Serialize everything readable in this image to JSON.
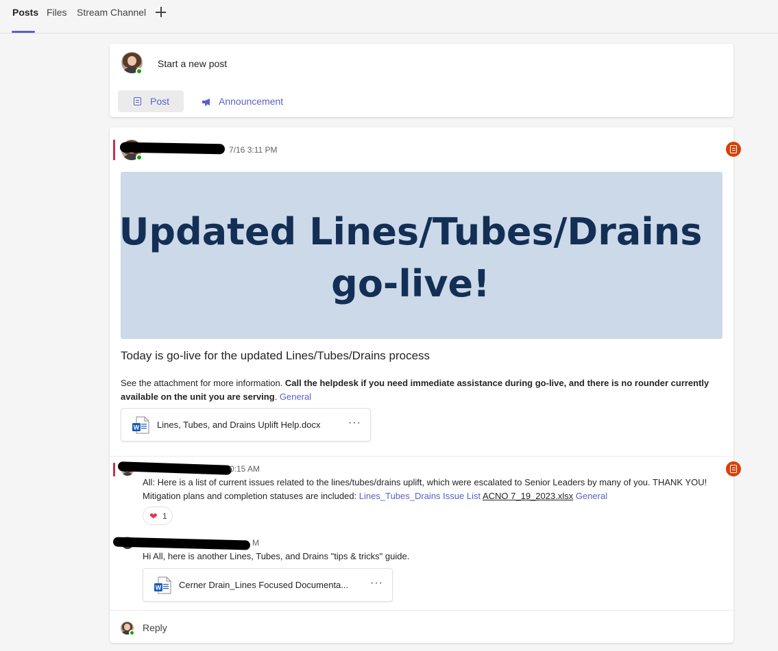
{
  "tabs": [
    {
      "label": "Posts",
      "active": true
    },
    {
      "label": "Files",
      "active": false
    },
    {
      "label": "Stream Channel",
      "active": false
    }
  ],
  "new_post": {
    "prompt": "Start a new post",
    "post_label": "Post",
    "announcement_label": "Announcement"
  },
  "post": {
    "timestamp": "7/16 3:11 PM",
    "banner_title": "Updated Lines/Tubes/Drains go-live!",
    "subject": "Today is go-live for the updated Lines/Tubes/Drains process",
    "body_intro": "See the attachment for more information. ",
    "body_bold": "Call the helpdesk if you need immediate assistance during go-live, and there is no rounder currently available on the unit you are serving",
    "body_end": ". ",
    "channel_tag": "General",
    "attachment_name": "Lines, Tubes, and Drains Uplift Help.docx"
  },
  "replies": [
    {
      "timestamp_fragment": "0:15 AM",
      "text": "All: Here is a list of current issues related to the lines/tubes/drains uplift, which were escalated to Senior Leaders by many of you. THANK YOU! Mitigation plans and completion statuses are included: ",
      "link1": "Lines_Tubes_Drains Issue List",
      "link2": "ACNO 7_19_2023.xlsx",
      "channel_tag": "General",
      "reaction_emoji": "heart",
      "reaction_count": "1"
    },
    {
      "timestamp_fragment": "M",
      "text": "Hi All, here is another Lines, Tubes, and Drains \"tips & tricks\" guide.",
      "attachment_name": "Cerner Drain_Lines Focused Documenta..."
    }
  ],
  "reply_label": "Reply",
  "more_glyph": "···",
  "colors": {
    "accent": "#5b5fc7",
    "banner_bg": "#ccd9e8",
    "banner_text": "#142f55",
    "important_bar": "#c4314b",
    "presence": "#13a10e"
  }
}
